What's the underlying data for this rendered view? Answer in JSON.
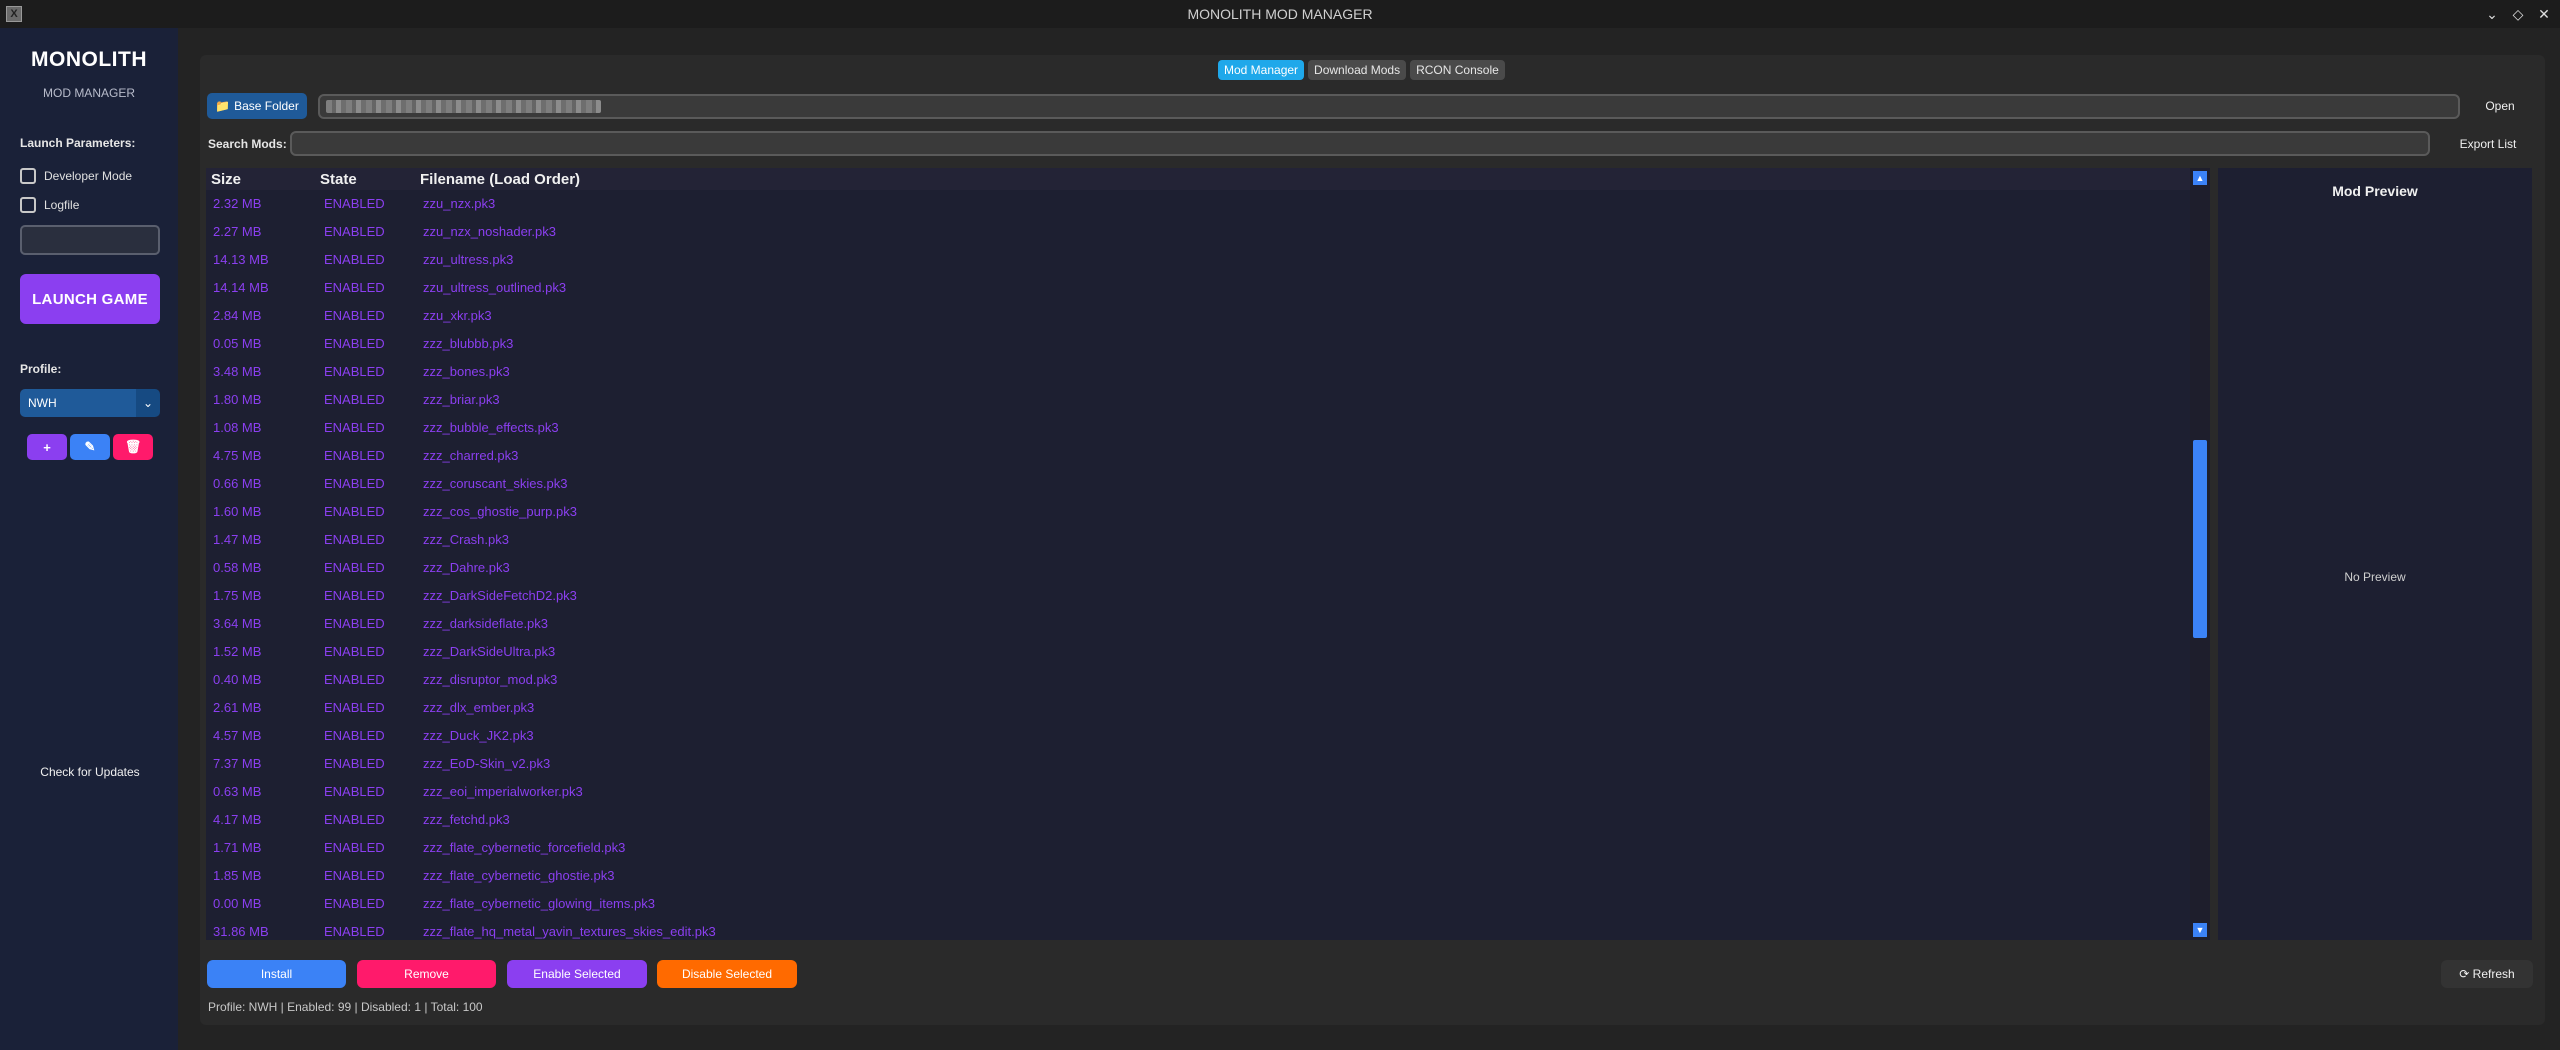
{
  "window": {
    "title": "MONOLITH MOD MANAGER",
    "icon_label": "X",
    "controls": [
      "⌄",
      "◇",
      "✕"
    ]
  },
  "sidebar": {
    "brand": "MONOLITH",
    "brand_sub": "MOD MANAGER",
    "launch_params_label": "Launch Parameters:",
    "developer_mode": {
      "label": "Developer Mode",
      "checked": false
    },
    "logfile": {
      "label": "Logfile",
      "checked": false
    },
    "params_input_value": "",
    "launch_label": "LAUNCH GAME",
    "profile_label": "Profile:",
    "profile_value": "NWH",
    "profile_add": "+",
    "profile_edit": "✎",
    "profile_delete": "🗑",
    "check_updates": "Check for Updates"
  },
  "tabs": [
    {
      "label": "Mod Manager",
      "active": true
    },
    {
      "label": "Download Mods",
      "active": false
    },
    {
      "label": "RCON Console",
      "active": false
    }
  ],
  "toolbar": {
    "base_folder": "Base Folder",
    "open": "Open",
    "search_label": "Search Mods:",
    "search_value": "",
    "export_list": "Export List"
  },
  "list": {
    "headers": {
      "size": "Size",
      "state": "State",
      "filename": "Filename (Load Order)"
    },
    "rows": [
      {
        "size": "2.32 MB",
        "state": "ENABLED",
        "name": "zzu_nzx.pk3"
      },
      {
        "size": "2.27 MB",
        "state": "ENABLED",
        "name": "zzu_nzx_noshader.pk3"
      },
      {
        "size": "14.13 MB",
        "state": "ENABLED",
        "name": "zzu_ultress.pk3"
      },
      {
        "size": "14.14 MB",
        "state": "ENABLED",
        "name": "zzu_ultress_outlined.pk3"
      },
      {
        "size": "2.84 MB",
        "state": "ENABLED",
        "name": "zzu_xkr.pk3"
      },
      {
        "size": "0.05 MB",
        "state": "ENABLED",
        "name": "zzz_blubbb.pk3"
      },
      {
        "size": "3.48 MB",
        "state": "ENABLED",
        "name": "zzz_bones.pk3"
      },
      {
        "size": "1.80 MB",
        "state": "ENABLED",
        "name": "zzz_briar.pk3"
      },
      {
        "size": "1.08 MB",
        "state": "ENABLED",
        "name": "zzz_bubble_effects.pk3"
      },
      {
        "size": "4.75 MB",
        "state": "ENABLED",
        "name": "zzz_charred.pk3"
      },
      {
        "size": "0.66 MB",
        "state": "ENABLED",
        "name": "zzz_coruscant_skies.pk3"
      },
      {
        "size": "1.60 MB",
        "state": "ENABLED",
        "name": "zzz_cos_ghostie_purp.pk3"
      },
      {
        "size": "1.47 MB",
        "state": "ENABLED",
        "name": "zzz_Crash.pk3"
      },
      {
        "size": "0.58 MB",
        "state": "ENABLED",
        "name": "zzz_Dahre.pk3"
      },
      {
        "size": "1.75 MB",
        "state": "ENABLED",
        "name": "zzz_DarkSideFetchD2.pk3"
      },
      {
        "size": "3.64 MB",
        "state": "ENABLED",
        "name": "zzz_darksideflate.pk3"
      },
      {
        "size": "1.52 MB",
        "state": "ENABLED",
        "name": "zzz_DarkSideUltra.pk3"
      },
      {
        "size": "0.40 MB",
        "state": "ENABLED",
        "name": "zzz_disruptor_mod.pk3"
      },
      {
        "size": "2.61 MB",
        "state": "ENABLED",
        "name": "zzz_dlx_ember.pk3"
      },
      {
        "size": "4.57 MB",
        "state": "ENABLED",
        "name": "zzz_Duck_JK2.pk3"
      },
      {
        "size": "7.37 MB",
        "state": "ENABLED",
        "name": "zzz_EoD-Skin_v2.pk3"
      },
      {
        "size": "0.63 MB",
        "state": "ENABLED",
        "name": "zzz_eoi_imperialworker.pk3"
      },
      {
        "size": "4.17 MB",
        "state": "ENABLED",
        "name": "zzz_fetchd.pk3"
      },
      {
        "size": "1.71 MB",
        "state": "ENABLED",
        "name": "zzz_flate_cybernetic_forcefield.pk3"
      },
      {
        "size": "1.85 MB",
        "state": "ENABLED",
        "name": "zzz_flate_cybernetic_ghostie.pk3"
      },
      {
        "size": "0.00 MB",
        "state": "ENABLED",
        "name": "zzz_flate_cybernetic_glowing_items.pk3"
      },
      {
        "size": "31.86 MB",
        "state": "ENABLED",
        "name": "zzz_flate_hq_metal_yavin_textures_skies_edit.pk3"
      }
    ]
  },
  "preview": {
    "title": "Mod Preview",
    "empty_text": "No Preview"
  },
  "actions": {
    "install": "Install",
    "remove": "Remove",
    "enable": "Enable Selected",
    "disable": "Disable Selected",
    "refresh": "⟳ Refresh"
  },
  "status": "Profile: NWH | Enabled: 99 | Disabled: 1 | Total: 100",
  "colors": {
    "accent_purple": "#8b3ff0",
    "tab_active": "#1fa8ea",
    "install": "#3b82f6",
    "remove": "#ff1a6b",
    "disable": "#ff6a00",
    "folder_button": "#1f5a99"
  }
}
